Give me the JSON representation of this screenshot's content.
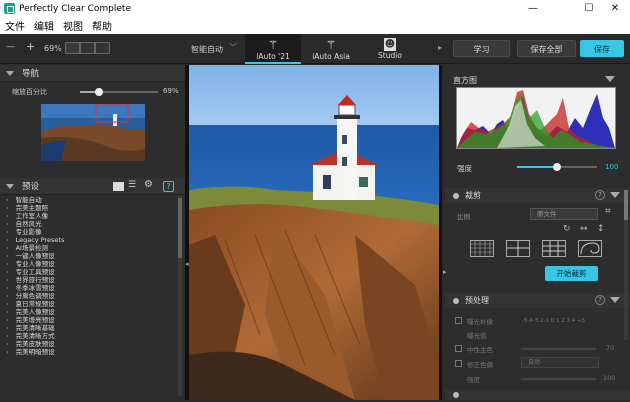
{
  "app": {
    "title": "Perfectly Clear Complete",
    "window_controls": {
      "minimize": "—",
      "maximize": "☐",
      "close": "✕"
    }
  },
  "menu": [
    "文件",
    "编辑",
    "视图",
    "帮助"
  ],
  "toolbar": {
    "zoom_out": "—",
    "zoom_in": "+",
    "zoom_value": "69%",
    "preset_dropdown": "智能自动",
    "modes": [
      {
        "label": "iAuto '21",
        "icon": "magic-wand-icon",
        "active": true
      },
      {
        "label": "iAuto Asia",
        "icon": "magic-wand-icon",
        "active": false
      },
      {
        "label": "Studio",
        "icon": "person-icon",
        "active": false
      }
    ],
    "learn": "学习",
    "save_all": "保存全部",
    "save": "保存"
  },
  "navigator": {
    "title": "导航",
    "zoom_label": "缩放百分比",
    "zoom_value": "69%",
    "zoom_fraction": 0.69
  },
  "presets": {
    "title": "预设",
    "items": [
      "智能自动",
      "完美主题照",
      "工作室人像",
      "自然风光",
      "专业影像",
      "Legacy Presets",
      "AI场景检测",
      "一键人像预设",
      "专业人像预设",
      "专业工具预设",
      "世界旅行预设",
      "冬季冰雪预设",
      "分离色调预设",
      "夏日常规预设",
      "完美人像预设",
      "完美增亮预设",
      "完美清晰基础",
      "完美清晰方式",
      "完美皮肤预设",
      "完美明暗预设"
    ]
  },
  "histogram": {
    "title": "直方图",
    "strength_label": "强度",
    "strength_value": "100",
    "strength_fraction": 1.0
  },
  "crop": {
    "title": "裁剪",
    "ratio_label": "比例",
    "ratio_value": "原文件",
    "start_button": "开始裁剪"
  },
  "preprocess": {
    "title": "预处理",
    "rows": [
      {
        "label": "曝光补偿",
        "value": ""
      },
      {
        "label": "曝光值",
        "value": "-5.4-3.2-1 0 1 2 3 4 +5"
      },
      {
        "label": "中性主色",
        "value": "70"
      },
      {
        "label": "修正色偏",
        "value": "自动"
      },
      {
        "label": "强度",
        "value": "100"
      }
    ]
  },
  "colors": {
    "accent": "#38c6e6",
    "panel": "#2d2d2d",
    "highlight_box": "#e03030"
  }
}
